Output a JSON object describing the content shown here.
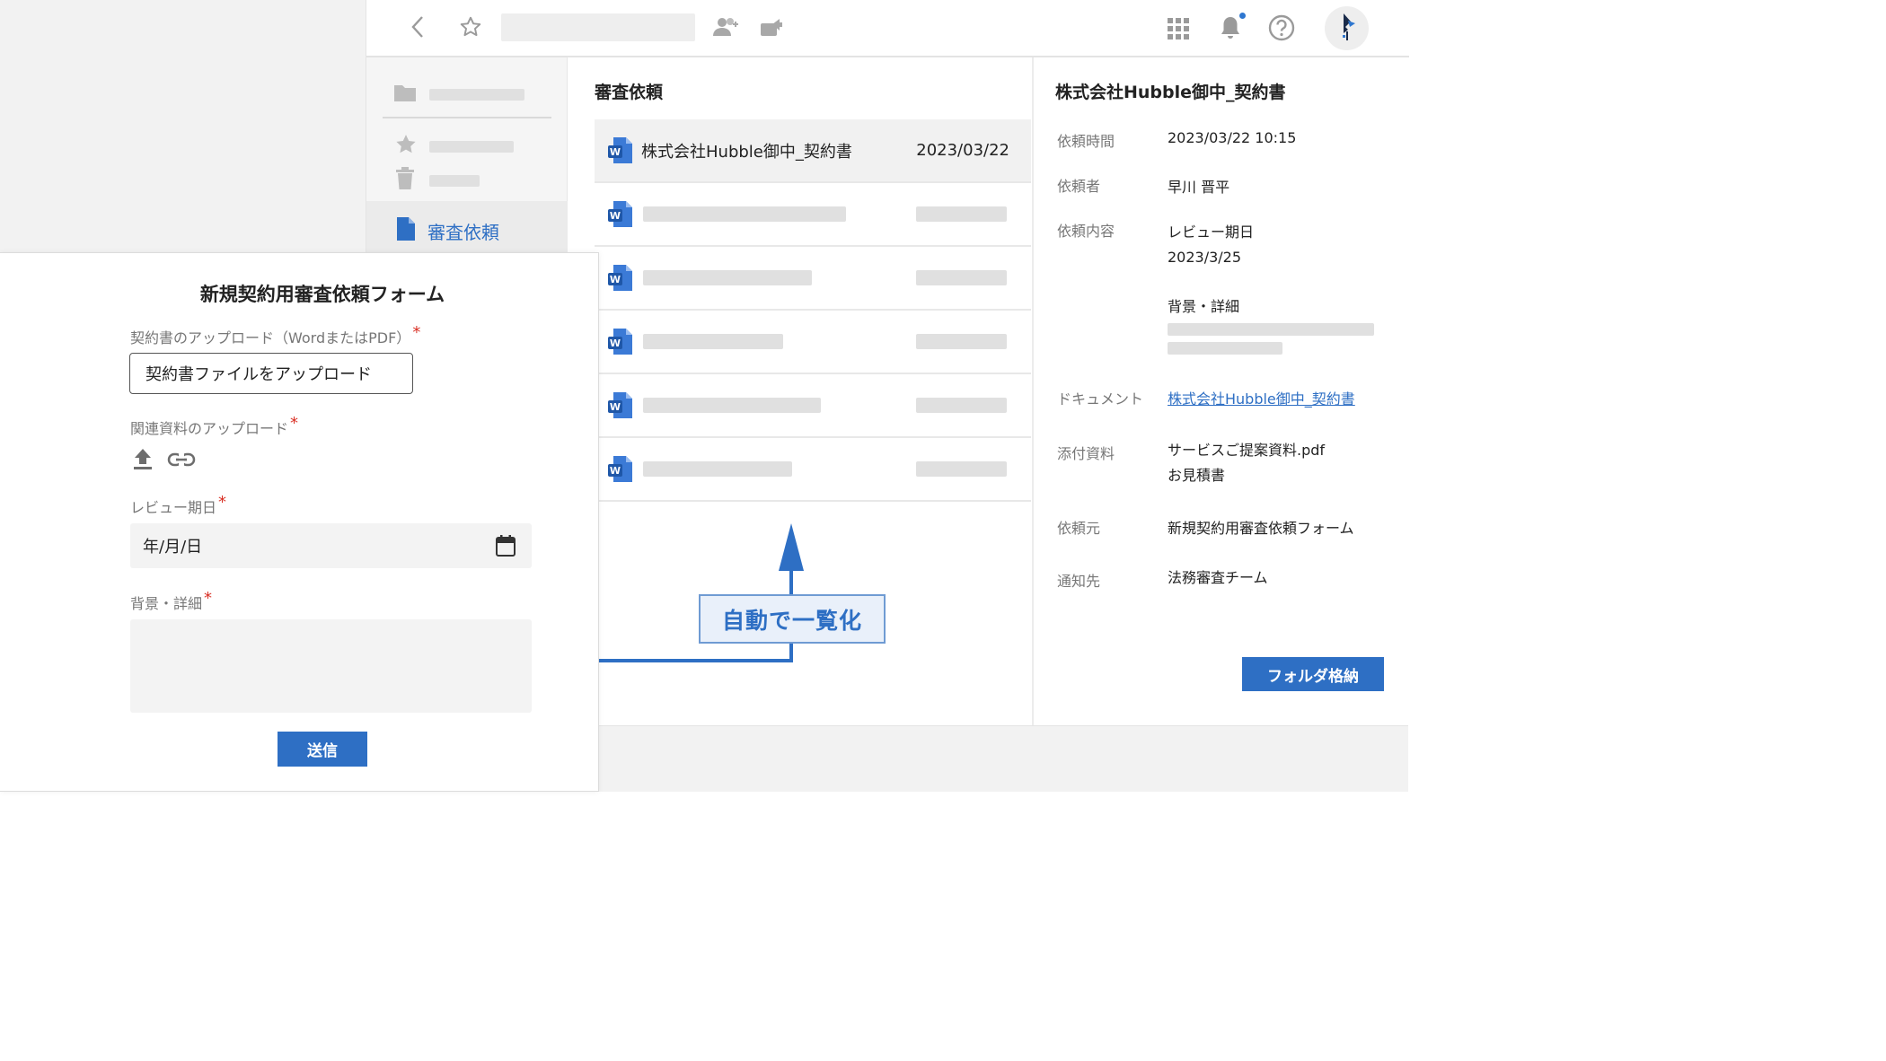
{
  "sidebar": {
    "active_label": "審査依頼"
  },
  "list": {
    "title": "審査依頼",
    "first_row": {
      "name": "株式会社Hubble御中_契約書",
      "date": "2023/03/22"
    }
  },
  "detail": {
    "title": "株式会社Hubble御中_契約書",
    "fields": {
      "request_time_label": "依頼時間",
      "request_time_value": "2023/03/22 10:15",
      "requester_label": "依頼者",
      "requester_value": "早川 晋平",
      "content_label": "依頼内容",
      "content_value_1": "レビュー期日",
      "content_value_2": "2023/3/25",
      "content_value_3": "背景・詳細",
      "document_label": "ドキュメント",
      "document_value": "株式会社Hubble御中_契約書",
      "attachments_label": "添付資料",
      "attachment_1": "サービスご提案資料.pdf",
      "attachment_2": "お見積書",
      "source_label": "依頼元",
      "source_value": "新規契約用審査依頼フォーム",
      "notify_label": "通知先",
      "notify_value": "法務審査チーム"
    },
    "folder_button": "フォルダ格納"
  },
  "annotation": {
    "text": "自動で一覧化"
  },
  "form": {
    "title": "新規契約用審査依頼フォーム",
    "upload_label": "契約書のアップロード（WordまたはPDF）",
    "upload_button": "契約書ファイルをアップロード",
    "related_label": "関連資料のアップロード",
    "review_label": "レビュー期日",
    "date_placeholder": "年/月/日",
    "background_label": "背景・詳細",
    "required_mark": "*",
    "submit": "送信"
  },
  "colors": {
    "accent": "#2e6fc4",
    "required": "#d93025",
    "annotation_bg": "#e9f0fa"
  },
  "icons": [
    "back-arrow-icon",
    "star-icon",
    "share-user-icon",
    "move-icon",
    "apps-grid-icon",
    "bell-icon",
    "help-icon",
    "avatar-logo-icon",
    "folder-icon",
    "trash-icon",
    "document-icon",
    "word-file-icon",
    "upload-icon",
    "link-icon",
    "calendar-icon"
  ]
}
